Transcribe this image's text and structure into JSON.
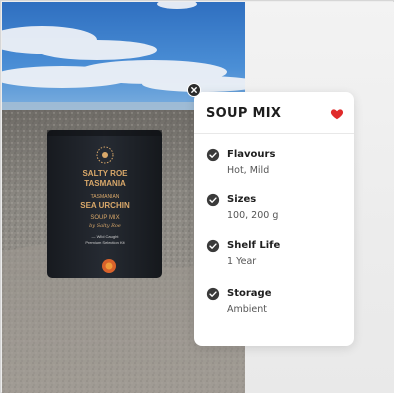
{
  "card": {
    "title": "SOUP MIX",
    "specs": [
      {
        "label": "Flavours",
        "value": "Hot, Mild"
      },
      {
        "label": "Sizes",
        "value": "100, 200 g"
      },
      {
        "label": "Shelf Life",
        "value": "1 Year"
      },
      {
        "label": "Storage",
        "value": "Ambient"
      }
    ],
    "heart_icon": "heart-icon",
    "check_icon": "check-circle-icon",
    "close_icon": "close-icon"
  },
  "product": {
    "brand_line1": "SALTY ROE",
    "brand_line2": "TASMANIA",
    "variant_line1": "TASMANIAN",
    "variant_line2": "SEA URCHIN",
    "product_name": "SOUP MIX",
    "tagline": "by Salty Roe",
    "note_line1": "— Wild Caught",
    "note_line2": "Premium Selection Kit"
  },
  "colors": {
    "heart": "#e02a2a",
    "check": "#3a3a3a",
    "jar": "#22262d",
    "label_text": "#d9a86a"
  }
}
